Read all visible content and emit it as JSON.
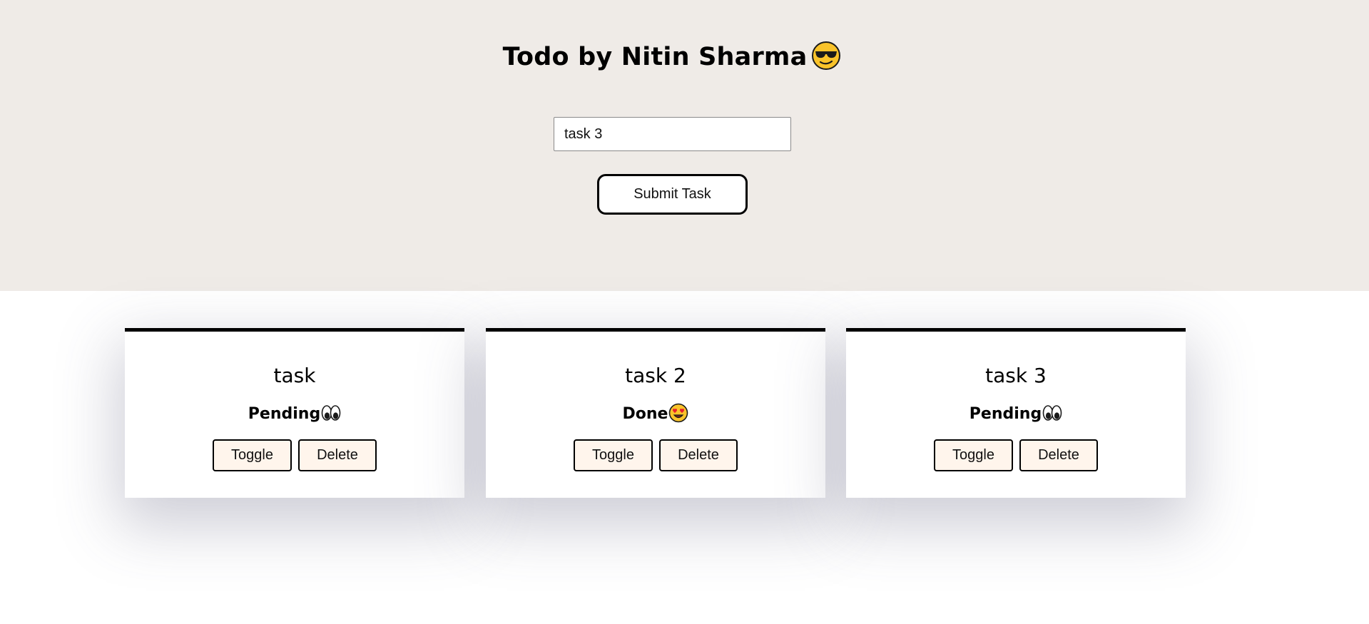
{
  "header": {
    "title": "Todo by Nitin Sharma",
    "title_emoji": "smiling-face-with-sunglasses-icon",
    "input_value": "task 3",
    "submit_label": "Submit Task",
    "background_color": "#efebe7"
  },
  "tasks": [
    {
      "title": "task",
      "status": "Pending",
      "status_icon": "eyes-icon",
      "toggle_label": "Toggle",
      "delete_label": "Delete"
    },
    {
      "title": "task 2",
      "status": "Done",
      "status_icon": "heart-eyes-face-icon",
      "toggle_label": "Toggle",
      "delete_label": "Delete"
    },
    {
      "title": "task 3",
      "status": "Pending",
      "status_icon": "eyes-icon",
      "toggle_label": "Toggle",
      "delete_label": "Delete"
    }
  ],
  "colors": {
    "card_button_bg": "#fff5ec",
    "card_border_top": "#000000"
  }
}
